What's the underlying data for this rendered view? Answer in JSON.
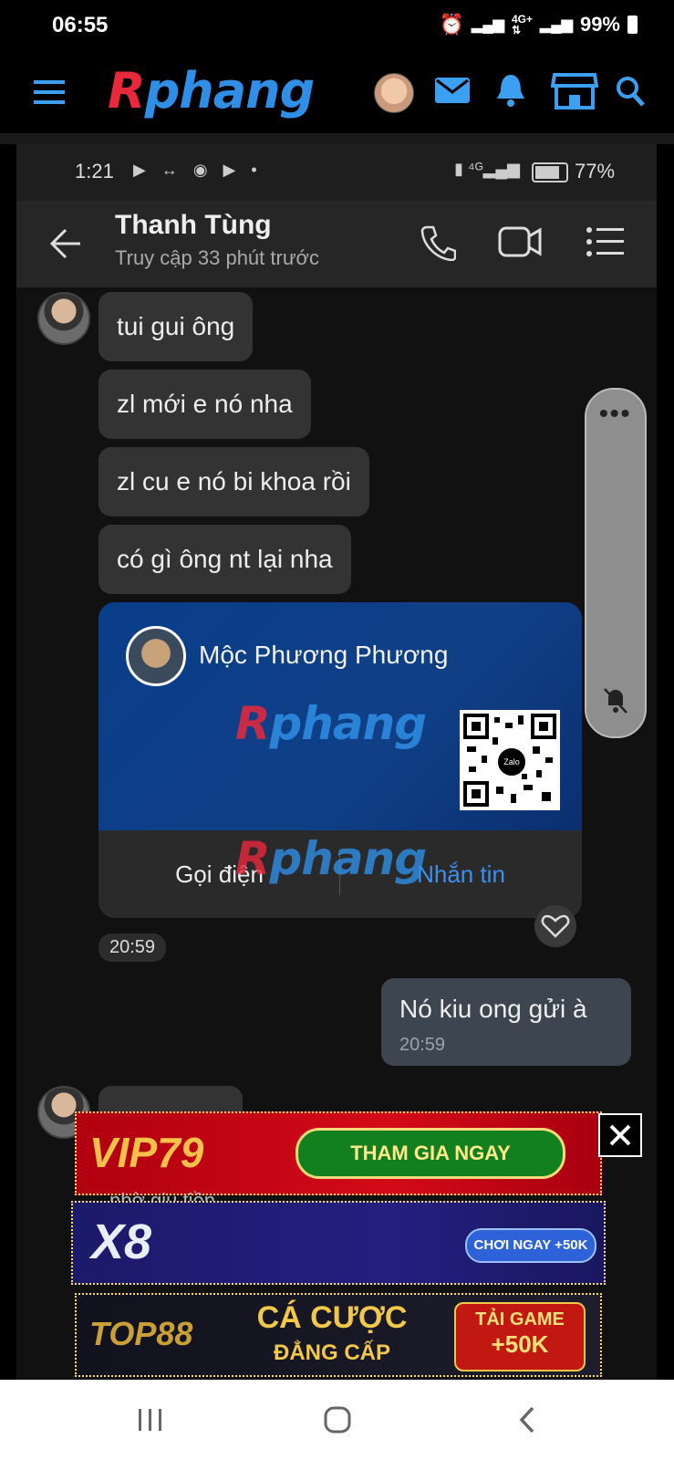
{
  "outer_status": {
    "time": "06:55",
    "battery": "99%"
  },
  "site": {
    "logo_a": "R",
    "logo_rest": "phang"
  },
  "inner_status": {
    "time": "1:21",
    "battery": "77%"
  },
  "chat_header": {
    "name": "Thanh Tùng",
    "subtitle": "Truy cập 33 phút trước"
  },
  "messages": [
    {
      "text": "tui gui ông"
    },
    {
      "text": "zl mới e nó nha"
    },
    {
      "text": "zl cu e nó bi khoa rồi"
    },
    {
      "text": "có gì ông nt lại nha"
    }
  ],
  "contact_card": {
    "name": "Mộc Phương Phương",
    "call_label": "Gọi điện",
    "message_label": "Nhắn tin",
    "qr_label": "Zalo"
  },
  "received_time": "20:59",
  "my_message": {
    "text": "Nó kiu ong gửi à",
    "time": "20:59"
  },
  "ads": [
    {
      "brand": "VIP79",
      "cta": "THAM GIA NGAY"
    },
    {
      "brand": "X8",
      "cta": "CHƠI NGAY +50K"
    },
    {
      "brand": "TOP88",
      "headline_1": "CÁ CƯỢC",
      "headline_2": "ĐẲNG CẤP",
      "cta_1": "TẢI GAME",
      "cta_2": "+50K"
    }
  ],
  "partial_text": "nhờ giu tiền",
  "icons": [
    "menu-icon",
    "mail-icon",
    "bell-icon",
    "store-icon",
    "search-icon",
    "back-icon",
    "phone-icon",
    "video-icon",
    "list-icon",
    "more-icon",
    "heart-icon",
    "close-icon"
  ]
}
